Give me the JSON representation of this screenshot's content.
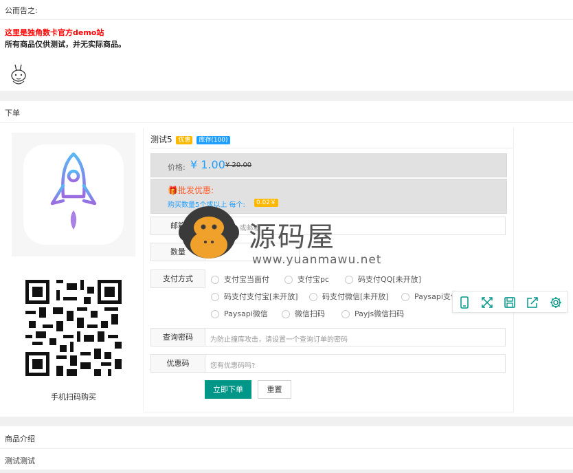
{
  "notice": {
    "title": "公而告之:",
    "line1": "这里是独角数卡官方demo站",
    "line2": "所有商品仅供测试，并无实际商品。"
  },
  "order_section_title": "下单",
  "product": {
    "name": "测试5",
    "badge_tag": "优惠",
    "badge_stock": "库存(100)",
    "price_label": "价格:",
    "price": "¥ 1.00",
    "price_original": "¥ 20.00",
    "wholesale_title": "批发优惠:",
    "wholesale_rule": "购买数量5个或以上 每个:",
    "wholesale_price": "0.02￥"
  },
  "qr": {
    "caption": "手机扫码购买"
  },
  "form": {
    "email_label": "邮箱",
    "email_placeholder": "...或邮箱",
    "quantity_label": "数量",
    "quantity_value": "1",
    "payment_label": "支付方式",
    "payment_options": [
      "支付宝当面付",
      "支付宝pc",
      "码支付QQ[未开放]",
      "码支付支付宝[未开放]",
      "码支付微信[未开放]",
      "Paysapi支付",
      "Paysapi微信",
      "微信扫码",
      "Payjs微信扫码"
    ],
    "query_password_label": "查询密码",
    "query_password_placeholder": "为防止撞库攻击，请设置一个查询订单的密码",
    "coupon_label": "优惠码",
    "coupon_placeholder": "您有优惠码吗?",
    "submit_label": "立即下单",
    "reset_label": "重置"
  },
  "intro_section_title": "商品介绍",
  "intro_text": "测试测试",
  "watermark": {
    "brand": "源码屋",
    "url": "www.yuanmawu.net"
  },
  "colors": {
    "accent_green": "#009688",
    "price_blue": "#1e9fff",
    "badge_orange": "#ffb800",
    "badge_blue": "#1e9fff",
    "notice_red": "#ff0000",
    "wholesale_red": "#ff5722"
  }
}
